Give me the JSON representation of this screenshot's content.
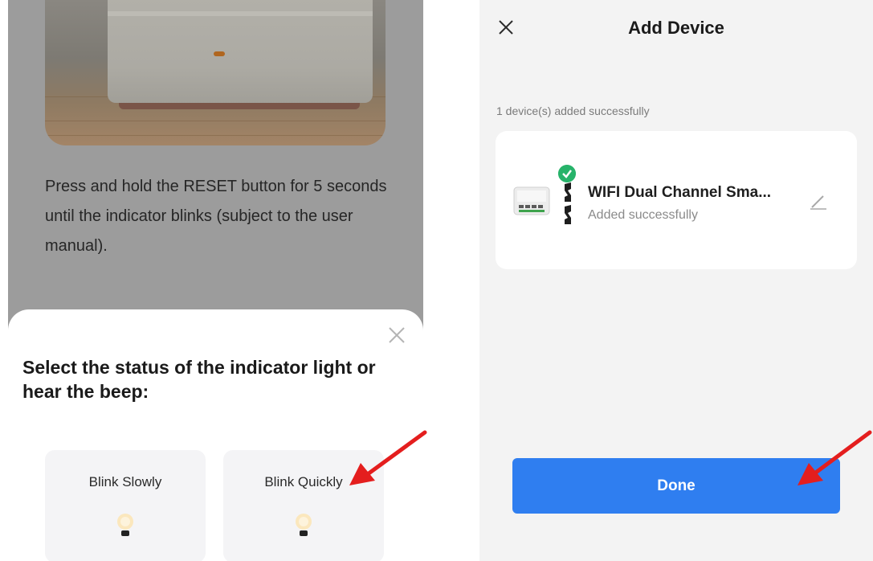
{
  "left": {
    "instruction": "Press and hold the RESET button for 5 seconds until the indicator blinks (subject to the user manual).",
    "sheet": {
      "title": "Select the status of the indicator light or hear the beep:",
      "close_icon": "close-icon",
      "options": [
        {
          "label": "Blink Slowly",
          "icon": "bulb-icon"
        },
        {
          "label": "Blink Quickly",
          "icon": "bulb-icon"
        }
      ]
    }
  },
  "right": {
    "header": {
      "title": "Add Device",
      "close_icon": "close-icon"
    },
    "success_text": "1 device(s) added successfully",
    "device": {
      "name": "WIFI Dual Channel Sma...",
      "status": "Added successfully",
      "edit_icon": "pencil-icon",
      "badge_icon": "check-icon"
    },
    "done_label": "Done"
  },
  "colors": {
    "primary_button": "#2f7ef0",
    "success_badge": "#27b36a",
    "annotation_arrow": "#e41e1e",
    "overlay_dim": "#9c9c9c"
  }
}
